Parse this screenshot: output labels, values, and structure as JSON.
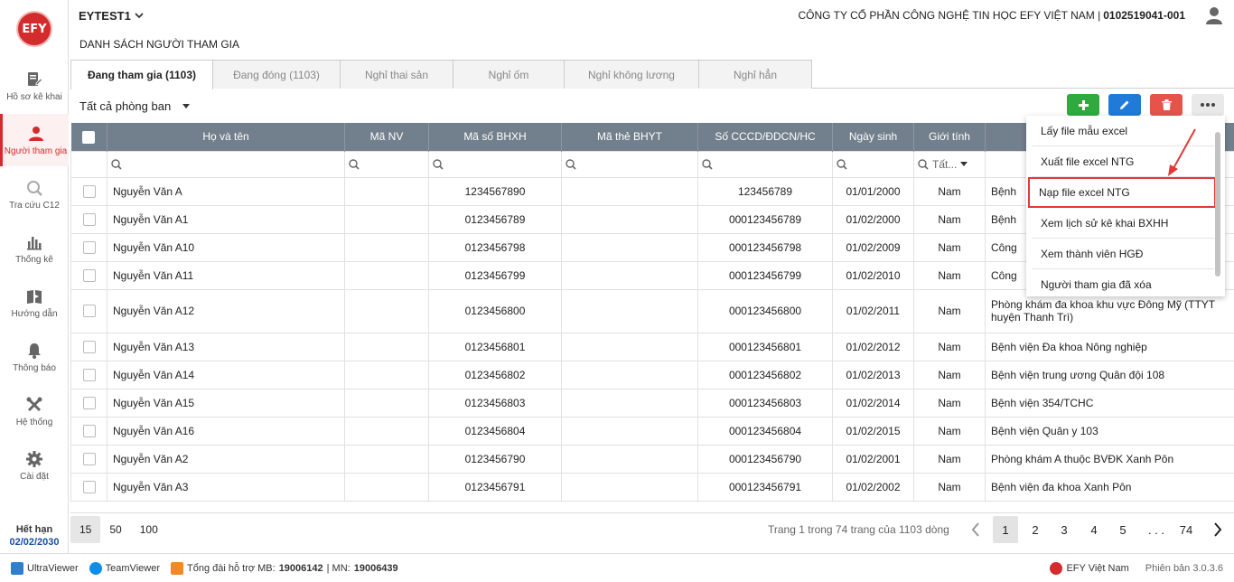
{
  "app": {
    "logo_text": "EFY",
    "tenant": "EYTEST1",
    "company_name": "CÔNG TY CỔ PHẦN CÔNG NGHỆ TIN HỌC EFY VIỆT NAM |",
    "tax_code": "0102519041-001"
  },
  "sidebar": {
    "items": [
      {
        "label": "Hồ sơ kê khai",
        "icon": "document-edit-icon"
      },
      {
        "label": "Người tham gia",
        "icon": "user-icon"
      },
      {
        "label": "Tra cứu C12",
        "icon": "magnifier-icon"
      },
      {
        "label": "Thống kê",
        "icon": "bar-chart-icon"
      },
      {
        "label": "Hướng dẫn",
        "icon": "book-icon"
      },
      {
        "label": "Thông báo",
        "icon": "bell-icon"
      },
      {
        "label": "Hệ thống",
        "icon": "tools-icon"
      },
      {
        "label": "Cài đặt",
        "icon": "gear-icon"
      }
    ],
    "expiry_label": "Hết hạn",
    "expiry_date": "02/02/2030"
  },
  "page_title": "DANH SÁCH NGƯỜI THAM GIA",
  "tabs": [
    {
      "label": "Đang tham gia (1103)"
    },
    {
      "label": "Đang đóng (1103)"
    },
    {
      "label": "Nghỉ thai sản"
    },
    {
      "label": "Nghỉ ốm"
    },
    {
      "label": "Nghỉ không lương"
    },
    {
      "label": "Nghỉ hẳn"
    }
  ],
  "department_filter": "Tất cả phòng ban",
  "toolbar_colors": {
    "add": "#2eaa3f",
    "edit": "#1f7ad8",
    "delete": "#e5534b"
  },
  "table": {
    "columns": [
      "Họ và tên",
      "Mã NV",
      "Mã số BHXH",
      "Mã thẻ BHYT",
      "Số CCCD/ĐDCN/HC",
      "Ngày sinh",
      "Giới tính",
      ""
    ],
    "gender_filter": "Tất...",
    "rows": [
      {
        "name": "Nguyễn Văn A",
        "bhxh": "1234567890",
        "cccd": "123456789",
        "dob": "01/01/2000",
        "gender": "Nam",
        "hospital": "Bệnh"
      },
      {
        "name": "Nguyễn Văn A1",
        "bhxh": "0123456789",
        "cccd": "000123456789",
        "dob": "01/02/2000",
        "gender": "Nam",
        "hospital": "Bệnh"
      },
      {
        "name": "Nguyễn Văn A10",
        "bhxh": "0123456798",
        "cccd": "000123456798",
        "dob": "01/02/2009",
        "gender": "Nam",
        "hospital": "Công"
      },
      {
        "name": "Nguyễn Văn A11",
        "bhxh": "0123456799",
        "cccd": "000123456799",
        "dob": "01/02/2010",
        "gender": "Nam",
        "hospital": "Công"
      },
      {
        "name": "Nguyễn Văn A12",
        "bhxh": "0123456800",
        "cccd": "000123456800",
        "dob": "01/02/2011",
        "gender": "Nam",
        "hospital": "Phòng khám đa khoa khu vực Đông Mỹ (TTYT huyện Thanh Trì)"
      },
      {
        "name": "Nguyễn Văn A13",
        "bhxh": "0123456801",
        "cccd": "000123456801",
        "dob": "01/02/2012",
        "gender": "Nam",
        "hospital": "Bệnh viện Đa khoa Nông nghiệp"
      },
      {
        "name": "Nguyễn Văn A14",
        "bhxh": "0123456802",
        "cccd": "000123456802",
        "dob": "01/02/2013",
        "gender": "Nam",
        "hospital": "Bệnh viện trung ương Quân đội 108"
      },
      {
        "name": "Nguyễn Văn A15",
        "bhxh": "0123456803",
        "cccd": "000123456803",
        "dob": "01/02/2014",
        "gender": "Nam",
        "hospital": "Bệnh viện 354/TCHC"
      },
      {
        "name": "Nguyễn Văn A16",
        "bhxh": "0123456804",
        "cccd": "000123456804",
        "dob": "01/02/2015",
        "gender": "Nam",
        "hospital": "Bệnh viện Quân y 103"
      },
      {
        "name": "Nguyễn Văn A2",
        "bhxh": "0123456790",
        "cccd": "000123456790",
        "dob": "01/02/2001",
        "gender": "Nam",
        "hospital": "Phòng khám A thuộc BVĐK Xanh Pôn"
      },
      {
        "name": "Nguyễn Văn A3",
        "bhxh": "0123456791",
        "cccd": "000123456791",
        "dob": "01/02/2002",
        "gender": "Nam",
        "hospital": "Bệnh viện đa khoa Xanh Pôn"
      }
    ]
  },
  "menu": {
    "items": [
      {
        "label": "Lấy file mẫu excel"
      },
      {
        "label": "Xuất file excel NTG"
      },
      {
        "label": "Nạp file excel NTG"
      },
      {
        "label": "Xem lịch sử kê khai BXHH"
      },
      {
        "label": "Xem thành viên HGĐ"
      },
      {
        "label": "Người tham gia đã xóa"
      }
    ]
  },
  "pager": {
    "sizes": [
      "15",
      "50",
      "100"
    ],
    "info": "Trang 1 trong 74 trang của 1103 dòng",
    "pages": [
      "1",
      "2",
      "3",
      "4",
      "5",
      ". . .",
      "74"
    ]
  },
  "footer": {
    "ultraviewer": "UltraViewer",
    "teamviewer": "TeamViewer",
    "support_label": "Tổng đài hỗ trợ MB:",
    "support_mb": "19006142",
    "support_sep": "| MN:",
    "support_mn": "19006439",
    "brand": "EFY Việt Nam",
    "version": "Phiên bản 3.0.3.6"
  }
}
